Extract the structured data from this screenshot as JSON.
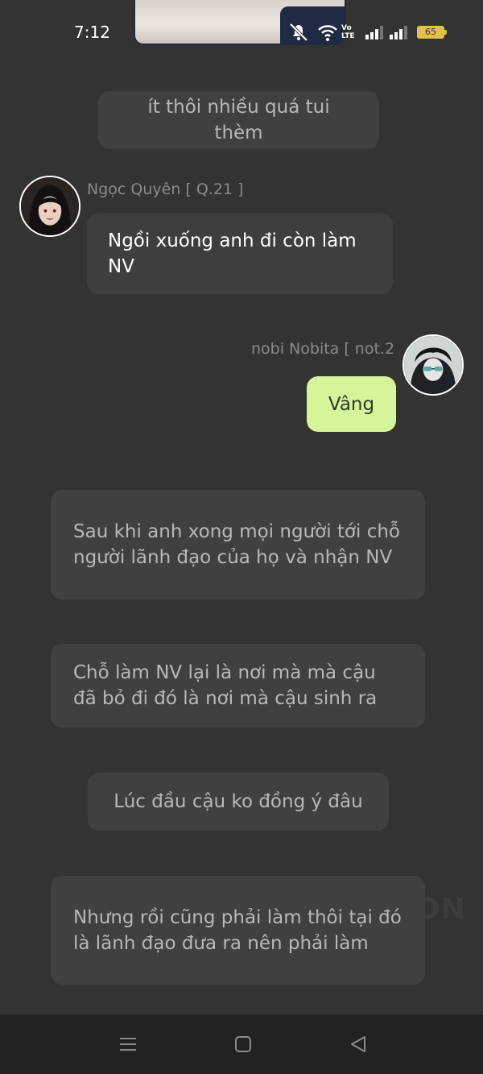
{
  "status_bar": {
    "time": "7:12",
    "battery_level": "65",
    "network_label": "Vo LTE",
    "icons": [
      "mute-icon",
      "wifi-icon",
      "volte-icon",
      "signal-icon",
      "signal-icon",
      "battery-icon"
    ]
  },
  "messages": [
    {
      "type": "narration",
      "text": "ít thôi nhiều quá tui thèm"
    },
    {
      "type": "incoming",
      "sender": "Ngọc Quyên [ Q.21 ]",
      "text": "Ngồi xuống anh đi còn làm NV"
    },
    {
      "type": "outgoing",
      "sender": "nobi Nobita [ not.2",
      "text": "Vâng"
    },
    {
      "type": "narration",
      "text": "Sau khi anh xong mọi người tới chỗ người lãnh đạo của họ và nhận NV"
    },
    {
      "type": "narration",
      "text": "Chỗ làm NV lại là nơi mà mà cậu đã bỏ đi đó là nơi mà cậu sinh ra"
    },
    {
      "type": "narration",
      "text": "Lúc đầu cậu ko đồng ý đâu"
    },
    {
      "type": "narration",
      "text": "Nhưng rồi cũng phải làm thôi tại đó là lãnh đạo đưa ra nên phải làm"
    }
  ],
  "watermark": "ON",
  "colors": {
    "background": "#333333",
    "bubble": "#404040",
    "outgoing_bubble": "#d4f59a",
    "navbar": "#222222"
  },
  "navbar": {
    "icons": [
      "menu-icon",
      "home-icon",
      "back-icon"
    ]
  }
}
